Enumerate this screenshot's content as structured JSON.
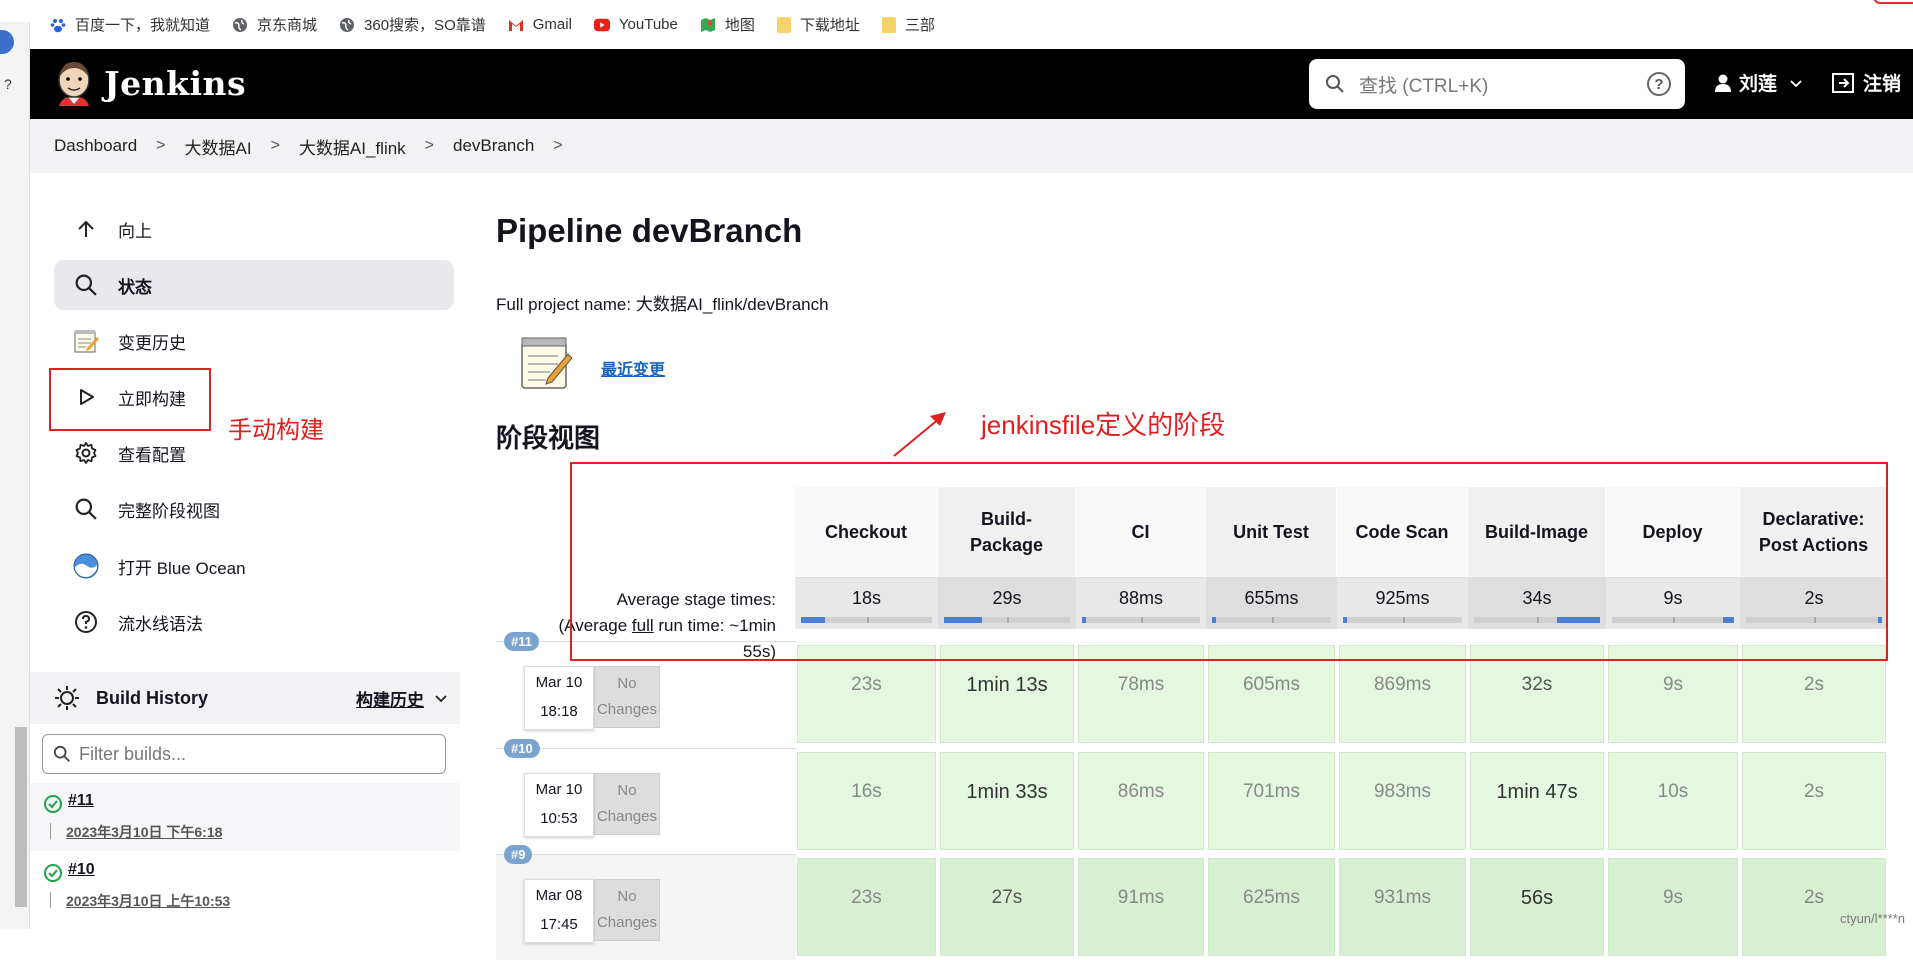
{
  "bookmarks": [
    {
      "label": "百度一下，我就知道",
      "icon": "paw-icon"
    },
    {
      "label": "京东商城",
      "icon": "globe-icon"
    },
    {
      "label": "360搜索，SO靠谱",
      "icon": "globe-icon"
    },
    {
      "label": "Gmail",
      "icon": "gmail-icon"
    },
    {
      "label": "YouTube",
      "icon": "youtube-icon"
    },
    {
      "label": "地图",
      "icon": "map-icon"
    },
    {
      "label": "下载地址",
      "icon": "folder-icon"
    },
    {
      "label": "三部",
      "icon": "folder-icon"
    }
  ],
  "browser_strip": {
    "help": "?"
  },
  "header": {
    "brand": "Jenkins",
    "search_placeholder": "查找 (CTRL+K)",
    "help": "?",
    "user": "刘莲",
    "logout": "注销"
  },
  "breadcrumb": [
    "Dashboard",
    "大数据AI",
    "大数据AI_flink",
    "devBranch"
  ],
  "sidebar": {
    "tasks": [
      {
        "label": "向上",
        "icon": "arrow-up-icon"
      },
      {
        "label": "状态",
        "icon": "search-icon",
        "active": true
      },
      {
        "label": "变更历史",
        "icon": "notepad-icon"
      },
      {
        "label": "立即构建",
        "icon": "play-icon"
      },
      {
        "label": "查看配置",
        "icon": "gear-icon"
      },
      {
        "label": "完整阶段视图",
        "icon": "search-icon"
      },
      {
        "label": "打开 Blue Ocean",
        "icon": "blue-ocean-icon"
      },
      {
        "label": "流水线语法",
        "icon": "help-circle-icon"
      }
    ],
    "annotation": "手动构建",
    "build_history": {
      "title": "Build History",
      "trend": "构建历史",
      "filter_placeholder": "Filter builds...",
      "builds": [
        {
          "number": "#11",
          "date": "2023年3月10日 下午6:18"
        },
        {
          "number": "#10",
          "date": "2023年3月10日 上午10:53"
        }
      ]
    }
  },
  "main": {
    "title": "Pipeline devBranch",
    "full_name": "Full project name: 大数据AI_flink/devBranch",
    "recent_changes": "最近变更",
    "stage_view_title": "阶段视图",
    "annotation": "jenkinsfile定义的阶段",
    "avg_label_1": "Average stage times:",
    "avg_label_2a": "(Average ",
    "avg_label_2b": "full",
    "avg_label_2c": " run time: ~1min",
    "avg_label_3": "55s)",
    "no_changes": "No Changes"
  },
  "stages": [
    {
      "name": "Checkout",
      "avg": "18s",
      "fill": 0.18
    },
    {
      "name": "Build-Package",
      "avg": "29s",
      "fill": 0.3
    },
    {
      "name": "CI",
      "avg": "88ms",
      "fill": 0.02
    },
    {
      "name": "Unit Test",
      "avg": "655ms",
      "fill": 0.03
    },
    {
      "name": "Code Scan",
      "avg": "925ms",
      "fill": 0.03
    },
    {
      "name": "Build-Image",
      "avg": "34s",
      "fill": 0.34
    },
    {
      "name": "Deploy",
      "avg": "9s",
      "fill": 0.09
    },
    {
      "name": "Declarative: Post Actions",
      "avg": "2s",
      "fill": 0.02
    }
  ],
  "builds": [
    {
      "badge": "#11",
      "month_day": "Mar 10",
      "time": "18:18",
      "cells": [
        "23s",
        "1min 13s",
        "78ms",
        "605ms",
        "869ms",
        "32s",
        "9s",
        "2s"
      ]
    },
    {
      "badge": "#10",
      "month_day": "Mar 10",
      "time": "10:53",
      "cells": [
        "16s",
        "1min 33s",
        "86ms",
        "701ms",
        "983ms",
        "1min 47s",
        "10s",
        "2s"
      ]
    },
    {
      "badge": "#9",
      "month_day": "Mar 08",
      "time": "17:45",
      "cells": [
        "23s",
        "27s",
        "91ms",
        "625ms",
        "931ms",
        "56s",
        "9s",
        "2s"
      ]
    }
  ],
  "watermark": "ctyun/l****n",
  "colors": {
    "accent_red": "#e02020",
    "link_blue": "#1565c0",
    "success_green": "#1ea446",
    "stage_green": "#e4f8e0"
  }
}
